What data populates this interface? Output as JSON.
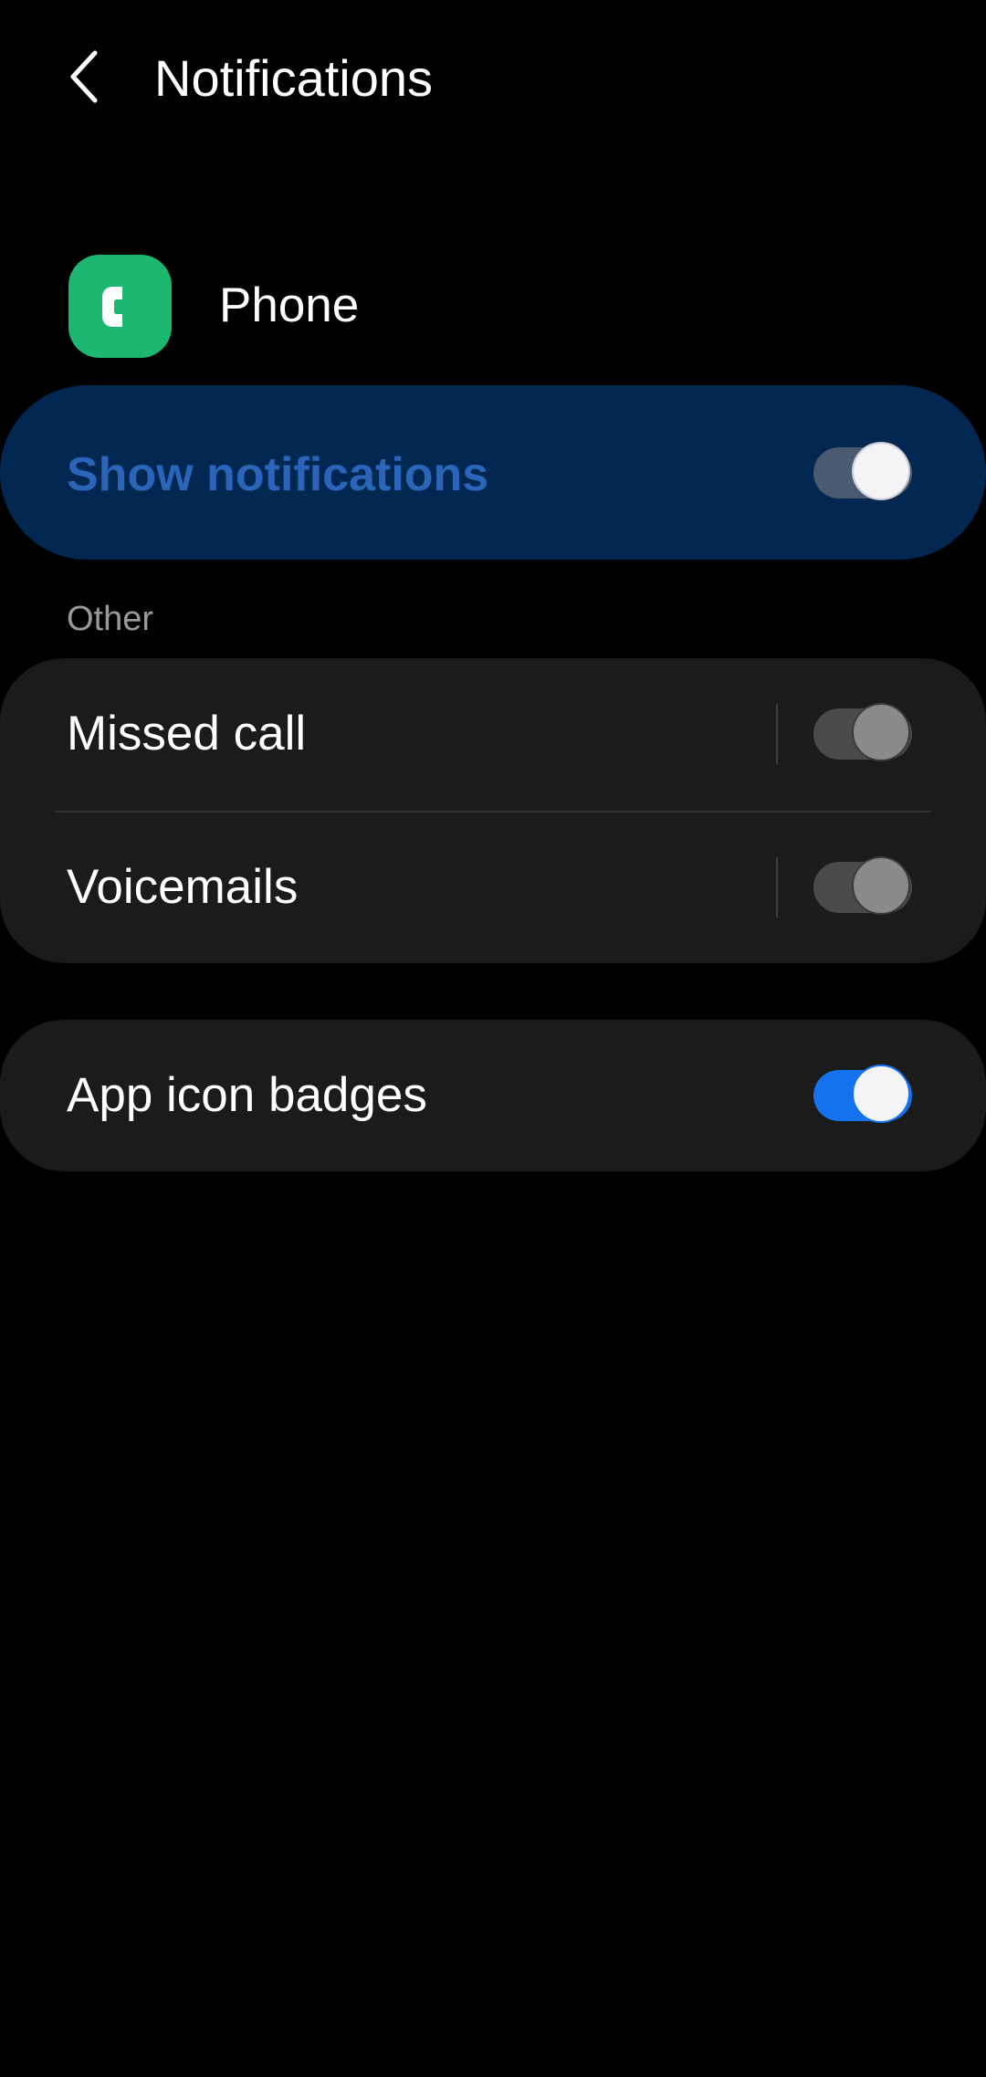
{
  "header": {
    "title": "Notifications",
    "back_icon": "chevron-left-icon"
  },
  "app": {
    "name": "Phone",
    "icon": "phone-app-icon",
    "icon_color": "#1db86f"
  },
  "master": {
    "label": "Show notifications",
    "enabled": true,
    "label_color": "#2a65b9",
    "card_color": "#022852"
  },
  "sections": {
    "other": {
      "title": "Other",
      "items": [
        {
          "label": "Missed call",
          "enabled": false
        },
        {
          "label": "Voicemails",
          "enabled": false
        }
      ]
    }
  },
  "badges": {
    "label": "App icon badges",
    "enabled": true,
    "accent_color": "#1472ee"
  }
}
